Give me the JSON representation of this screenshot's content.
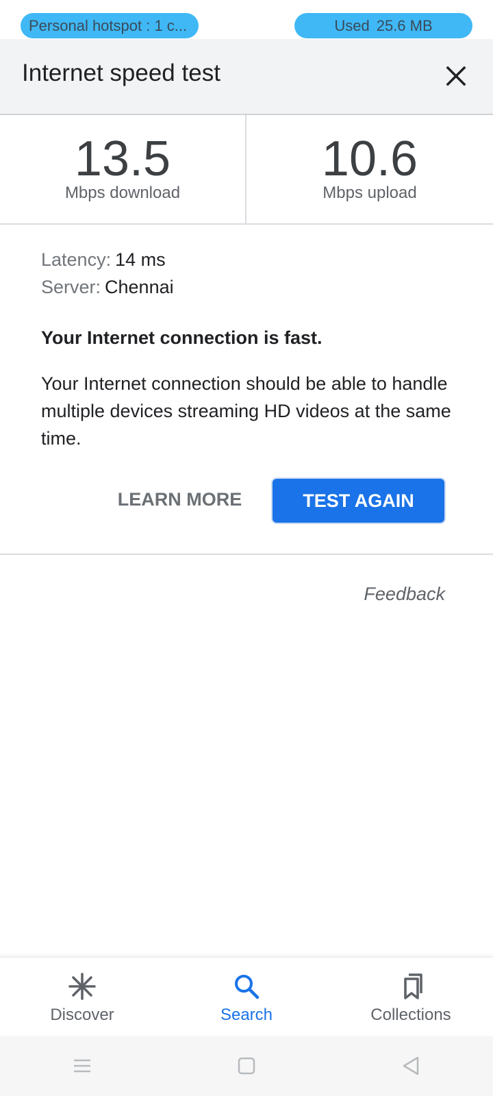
{
  "status": {
    "hotspot": "Personal hotspot : 1 c...",
    "used_label": "Used",
    "used_value": "25.6 MB"
  },
  "header": {
    "title": "Internet speed test"
  },
  "results": {
    "download": {
      "value": "13.5",
      "unit": "Mbps download"
    },
    "upload": {
      "value": "10.6",
      "unit": "Mbps upload"
    }
  },
  "details": {
    "latency_key": "Latency:",
    "latency_value": "14 ms",
    "server_key": "Server:",
    "server_value": "Chennai",
    "verdict": "Your Internet connection is fast.",
    "description": "Your Internet connection should be able to handle multiple devices streaming HD videos at the same time."
  },
  "actions": {
    "learn_more": "LEARN MORE",
    "test_again": "TEST AGAIN",
    "feedback": "Feedback"
  },
  "bottom_nav": {
    "items": [
      {
        "label": "Discover",
        "icon": "asterisk-icon"
      },
      {
        "label": "Search",
        "icon": "search-icon",
        "active": true
      },
      {
        "label": "Collections",
        "icon": "bookmarks-icon"
      }
    ]
  },
  "colors": {
    "accent": "#1a73e8",
    "pill": "#3fb8f5",
    "header_bg": "#f1f3f4"
  }
}
